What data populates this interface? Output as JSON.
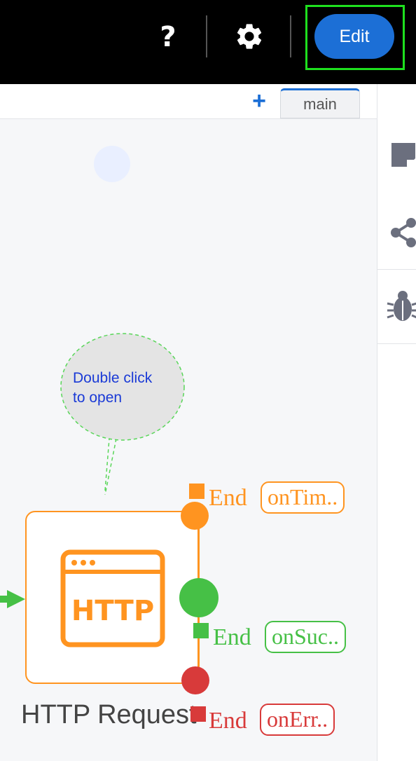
{
  "toolbar": {
    "help_label": "?",
    "edit_label": "Edit",
    "highlight_color": "#1ee01e",
    "edit_color": "#1c6fd6"
  },
  "tabs": {
    "add_label": "+",
    "items": [
      {
        "label": "main"
      }
    ]
  },
  "sidebar": {
    "icons": [
      "note-icon",
      "share-icon",
      "bug-icon"
    ]
  },
  "canvas": {
    "tooltip": {
      "text_line1": "Double click",
      "text_line2": "to open"
    },
    "node": {
      "label": "HTTP Request",
      "icon_text": "HTTP",
      "color": "#ff9420"
    },
    "outputs": [
      {
        "end_label": "End",
        "chip_label": "onTim..",
        "color": "#ff9420"
      },
      {
        "end_label": "End",
        "chip_label": "onSuc..",
        "color": "#46c046"
      },
      {
        "end_label": "End",
        "chip_label": "onErr..",
        "color": "#d83a3a"
      }
    ]
  }
}
